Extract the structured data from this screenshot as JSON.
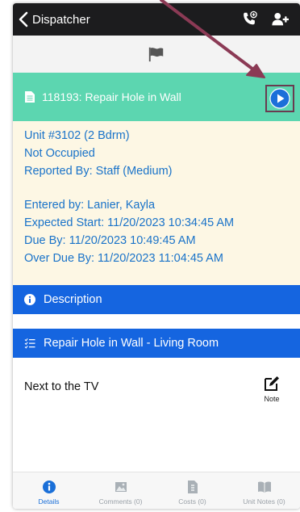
{
  "topbar": {
    "back_label": "Dispatcher",
    "call_icon": "phone-add-icon",
    "person_icon": "person-add-icon"
  },
  "flag": {
    "icon": "flag-icon"
  },
  "work_order": {
    "title": "118193: Repair Hole in Wall",
    "doc_icon": "document-icon",
    "play_icon": "play-circle-icon",
    "header_color": "#5cd6b0"
  },
  "details": {
    "unit": "Unit #3102 (2 Bdrm)",
    "occupancy": "Not Occupied",
    "reported_by": "Reported By: Staff  (Medium)",
    "entered_by": "Entered by: Lanier, Kayla",
    "expected_start": "Expected Start: 11/20/2023 10:34:45 AM",
    "due_by": "Due By: 11/20/2023 10:49:45 AM",
    "over_due_by": "Over Due By: 11/20/2023 11:04:45 AM",
    "text_color": "#1a73c9",
    "background": "#fdf7e4"
  },
  "description_bar": {
    "label": "Description",
    "icon": "info-icon"
  },
  "task_bar": {
    "label": "Repair Hole in Wall - Living Room",
    "icon": "checklist-icon"
  },
  "note": {
    "text": "Next to the TV",
    "button_label": "Note",
    "icon": "edit-note-icon"
  },
  "tabs": [
    {
      "label": "Details",
      "icon": "info-icon",
      "active": true
    },
    {
      "label": "Comments (0)",
      "icon": "image-icon",
      "active": false
    },
    {
      "label": "Costs (0)",
      "icon": "invoice-icon",
      "active": false
    },
    {
      "label": "Unit Notes (0)",
      "icon": "book-icon",
      "active": false
    }
  ],
  "colors": {
    "accent_blue": "#1565e0",
    "active_tab": "#1a6fd8",
    "annotation": "#8b3a55"
  }
}
